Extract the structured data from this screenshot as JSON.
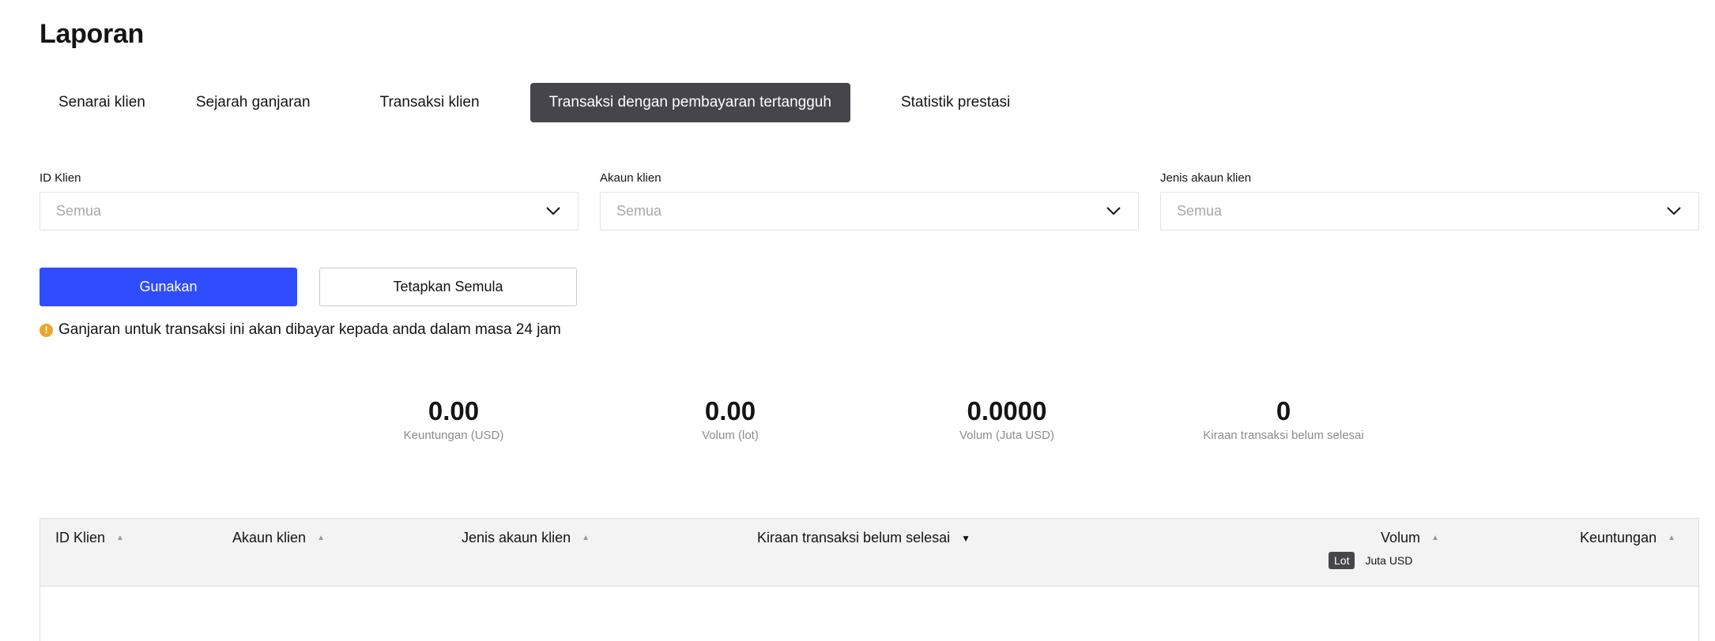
{
  "page": {
    "title": "Laporan"
  },
  "tabs": [
    {
      "label": "Senarai klien",
      "active": false
    },
    {
      "label": "Sejarah ganjaran",
      "active": false
    },
    {
      "label": "Transaksi klien",
      "active": false
    },
    {
      "label": "Transaksi dengan pembayaran tertangguh",
      "active": true
    },
    {
      "label": "Statistik prestasi",
      "active": false
    }
  ],
  "filters": {
    "client_id": {
      "label": "ID Klien",
      "value": "Semua"
    },
    "client_account": {
      "label": "Akaun klien",
      "value": "Semua"
    },
    "account_type": {
      "label": "Jenis akaun klien",
      "value": "Semua"
    }
  },
  "buttons": {
    "apply": "Gunakan",
    "reset": "Tetapkan Semula"
  },
  "notice": "Ganjaran untuk transaksi ini akan dibayar kepada anda dalam masa 24 jam",
  "stats": [
    {
      "value": "0.00",
      "label": "Keuntungan (USD)"
    },
    {
      "value": "0.00",
      "label": "Volum (lot)"
    },
    {
      "value": "0.0000",
      "label": "Volum (Juta USD)"
    },
    {
      "value": "0",
      "label": "Kiraan transaksi belum selesai"
    }
  ],
  "table": {
    "columns": [
      {
        "label": "ID Klien",
        "sort": "asc",
        "sort_active": false
      },
      {
        "label": "Akaun klien",
        "sort": "asc",
        "sort_active": false
      },
      {
        "label": "Jenis akaun klien",
        "sort": "asc",
        "sort_active": false
      },
      {
        "label": "Kiraan transaksi belum selesai",
        "sort": "desc",
        "sort_active": true
      },
      {
        "label": "Volum",
        "sort": "asc",
        "sort_active": false
      },
      {
        "label": "Keuntungan",
        "sort": "asc",
        "sort_active": false
      }
    ],
    "volume_units": [
      {
        "label": "Lot",
        "active": true
      },
      {
        "label": "Juta USD",
        "active": false
      }
    ]
  },
  "colors": {
    "accent": "#2f4cff",
    "tab_active": "#45454b",
    "info_icon": "#e9a82b"
  },
  "icons": {
    "select": "chevron-down-icon",
    "notice": "info-icon",
    "sort_asc": "sort-asc-icon",
    "sort_desc": "sort-desc-icon"
  }
}
